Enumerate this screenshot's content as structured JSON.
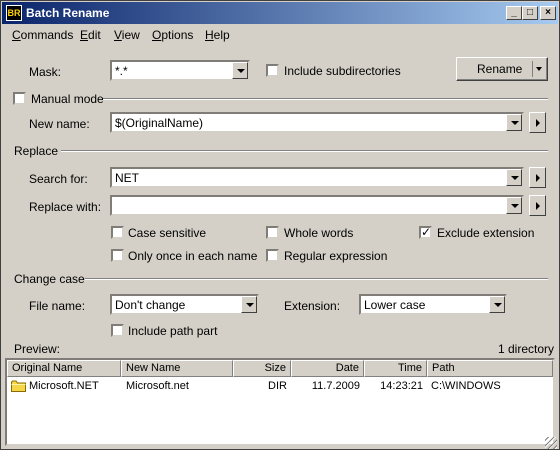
{
  "window": {
    "title": "Batch Rename",
    "app_icon": "batch-rename-app-icon"
  },
  "menu": [
    {
      "label": "Commands",
      "accel": "C",
      "rest": "ommands"
    },
    {
      "label": "Edit",
      "accel": "E",
      "rest": "dit"
    },
    {
      "label": "View",
      "accel": "V",
      "rest": "iew"
    },
    {
      "label": "Options",
      "accel": "O",
      "rest": "ptions"
    },
    {
      "label": "Help",
      "accel": "H",
      "rest": "elp"
    }
  ],
  "mask": {
    "label": "Mask:",
    "value": "*.*"
  },
  "include_subdirectories": {
    "label": "Include subdirectories",
    "checked": false
  },
  "rename_button": {
    "label": "Rename"
  },
  "manual_mode": {
    "label": "Manual mode",
    "checked": false
  },
  "new_name": {
    "label": "New name:",
    "value": "$(OriginalName)"
  },
  "replace": {
    "section_label": "Replace",
    "search_label": "Search for:",
    "search_value": "NET",
    "replace_label": "Replace with:",
    "replace_value": ""
  },
  "options": {
    "case_sensitive": {
      "label": "Case sensitive",
      "checked": false
    },
    "whole_words": {
      "label": "Whole words",
      "checked": false
    },
    "exclude_extension": {
      "label": "Exclude extension",
      "checked": true
    },
    "only_once": {
      "label": "Only once in each name",
      "checked": false
    },
    "regular_expression": {
      "label": "Regular expression",
      "checked": false
    }
  },
  "change_case": {
    "section_label": "Change case",
    "file_name_label": "File name:",
    "file_name_value": "Don't change",
    "extension_label": "Extension:",
    "extension_value": "Lower case",
    "include_path_label": "Include path part",
    "include_path_checked": false
  },
  "preview": {
    "label": "Preview:",
    "count": "1 directory",
    "columns": [
      "Original Name",
      "New Name",
      "Size",
      "Date",
      "Time",
      "Path"
    ],
    "rows": [
      {
        "icon": "folder-icon",
        "original": "Microsoft.NET",
        "new": "Microsoft.net",
        "size": "DIR",
        "date": "11.7.2009",
        "time": "14:23:21",
        "path": "C:\\WINDOWS"
      }
    ]
  },
  "colors": {
    "title_start": "#0a246a",
    "title_end": "#a6caf0",
    "face": "#d4d0c8"
  }
}
